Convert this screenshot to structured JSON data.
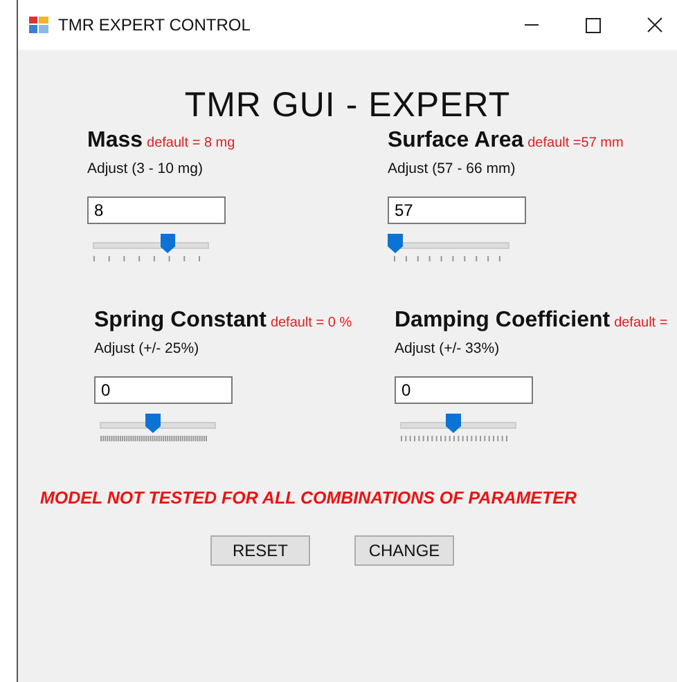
{
  "window": {
    "title": "TMR EXPERT CONTROL"
  },
  "heading": "TMR GUI - EXPERT",
  "parameters": [
    {
      "name": "Mass",
      "default": "default = 8 mg",
      "range": "Adjust (3 - 10 mg)",
      "value": "8",
      "level": 0.71
    },
    {
      "name": "Surface Area",
      "default": "default =57 mm",
      "range": "Adjust (57 - 66 mm)",
      "value": "57",
      "level": 0
    },
    {
      "name": "Spring Constant",
      "default": "default = 0 %",
      "range": "Adjust (+/- 25%)",
      "value": "0",
      "level": 0.5
    },
    {
      "name": "Damping Coefficient",
      "default": "default =",
      "range": "Adjust (+/- 33%)",
      "value": "0",
      "level": 0.5
    }
  ],
  "warning": "MODEL NOT TESTED FOR ALL COMBINATIONS OF PARAMETER",
  "buttons": [
    "RESET",
    "CHANGE"
  ]
}
